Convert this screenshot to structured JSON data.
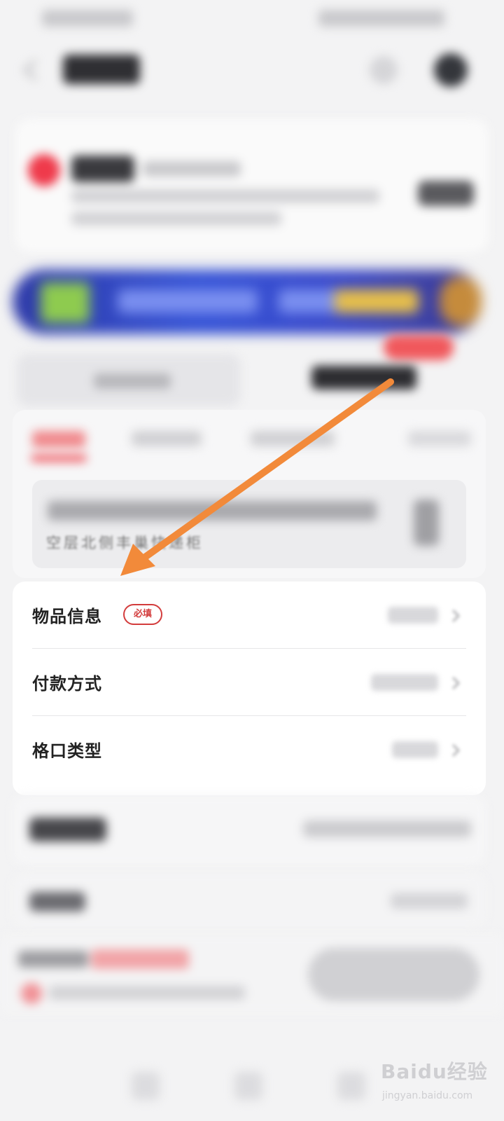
{
  "form": {
    "rows": [
      {
        "label": "物品信息",
        "badge": "必填"
      },
      {
        "label": "付款方式"
      },
      {
        "label": "格口类型"
      }
    ]
  },
  "cabinet": {
    "location_partial": "空层北侧丰巢快递柜"
  },
  "watermark": {
    "main": "Baidu经验",
    "sub": "jingyan.baidu.com"
  },
  "colors": {
    "accent_red": "#d33c3c",
    "arrow_orange": "#f28a3a",
    "banner_blue": "#3553d6"
  },
  "icons": [
    "back-icon",
    "more-icon",
    "avatar-icon",
    "chevron-right-icon",
    "pointer-arrow-icon"
  ]
}
